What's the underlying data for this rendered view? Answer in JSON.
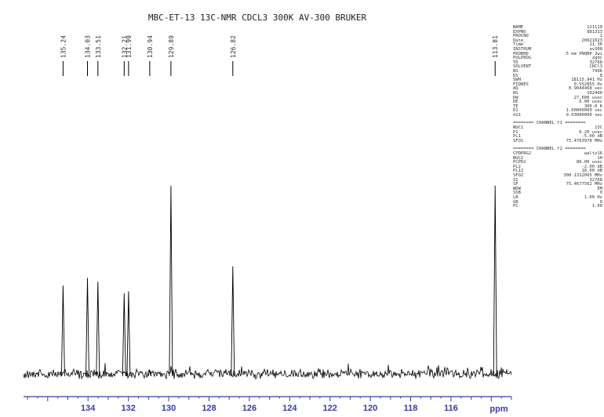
{
  "title": "MBC-ET-13 13C-NMR CDCL3 300K AV-300 BRUKER",
  "chart_data": {
    "type": "line",
    "title": "MBC-ET-13 13C-NMR CDCL3 300K AV-300 BRUKER",
    "xlabel": "ppm",
    "ylabel": "",
    "x_reversed": true,
    "xlim": [
      137.2,
      113.0
    ],
    "ylim": [
      -0.05,
      1.0
    ],
    "grid": false,
    "x_ticks": [
      134,
      132,
      130,
      128,
      126,
      124,
      122,
      120,
      118,
      116
    ],
    "peaks": [
      {
        "ppm": 135.24,
        "label": "135.24",
        "height": 0.46
      },
      {
        "ppm": 134.03,
        "label": "134.03",
        "height": 0.5
      },
      {
        "ppm": 133.51,
        "label": "133.51",
        "height": 0.48
      },
      {
        "ppm": 132.21,
        "label": "132.21",
        "height": 0.42
      },
      {
        "ppm": 131.99,
        "label": "131.99",
        "height": 0.43
      },
      {
        "ppm": 130.94,
        "label": "130.94",
        "height": 0.02
      },
      {
        "ppm": 129.89,
        "label": "129.89",
        "height": 0.98
      },
      {
        "ppm": 126.82,
        "label": "126.82",
        "height": 0.56
      },
      {
        "ppm": 113.81,
        "label": "113.81",
        "height": 0.98
      }
    ]
  },
  "parameters": {
    "acq": [
      {
        "k": "NAME",
        "v": "121110"
      },
      {
        "k": "EXPNO",
        "v": "881313"
      },
      {
        "k": "PROCNO",
        "v": "1"
      },
      {
        "k": "Date_",
        "v": "20021023"
      },
      {
        "k": "Time",
        "v": "21.36"
      },
      {
        "k": "INSTRUM",
        "v": "av300"
      },
      {
        "k": "PROBHD",
        "v": "5 mm PNQNP 2wi"
      },
      {
        "k": "PULPROG",
        "v": "zgdc"
      },
      {
        "k": "TD",
        "v": "32768"
      },
      {
        "k": "SOLVENT",
        "v": "CDCl3"
      },
      {
        "k": "NS",
        "v": "7496"
      },
      {
        "k": "DS",
        "v": "8"
      },
      {
        "k": "SWH",
        "v": "18115.941 Hz"
      },
      {
        "k": "FIDRES",
        "v": "0.552855 Hz"
      },
      {
        "k": "AQ",
        "v": "0.9044468 sec"
      },
      {
        "k": "RG",
        "v": "102400"
      },
      {
        "k": "DW",
        "v": "27.600 usec"
      },
      {
        "k": "DE",
        "v": "6.00 usec"
      },
      {
        "k": "TE",
        "v": "300.0 K"
      },
      {
        "k": "D1",
        "v": "1.00000000 sec"
      },
      {
        "k": "d11",
        "v": "0.03000000 sec"
      }
    ],
    "ch1_header": "======== CHANNEL f1 ========",
    "ch1": [
      {
        "k": "NUC1",
        "v": "13C"
      },
      {
        "k": "P1",
        "v": "6.20 usec"
      },
      {
        "k": "PL1",
        "v": "-5.00 dB"
      },
      {
        "k": "SFO1",
        "v": "75.4763978 MHz"
      }
    ],
    "ch2_header": "======== CHANNEL f2 ========",
    "ch2": [
      {
        "k": "CPDPRG2",
        "v": "waltz16"
      },
      {
        "k": "NUC2",
        "v": "1H"
      },
      {
        "k": "PCPD2",
        "v": "80.00 usec"
      },
      {
        "k": "PL2",
        "v": "-2.00 dB"
      },
      {
        "k": "PL12",
        "v": "18.00 dB"
      },
      {
        "k": "SFO2",
        "v": "300.1312005 MHz"
      },
      {
        "k": "SI",
        "v": "32768"
      },
      {
        "k": "SF",
        "v": "75.4677562 MHz"
      },
      {
        "k": "WDW",
        "v": "EM"
      },
      {
        "k": "SSB",
        "v": "0"
      },
      {
        "k": "LB",
        "v": "1.00 Hz"
      },
      {
        "k": "GB",
        "v": "0"
      },
      {
        "k": "PC",
        "v": "1.00"
      }
    ]
  }
}
